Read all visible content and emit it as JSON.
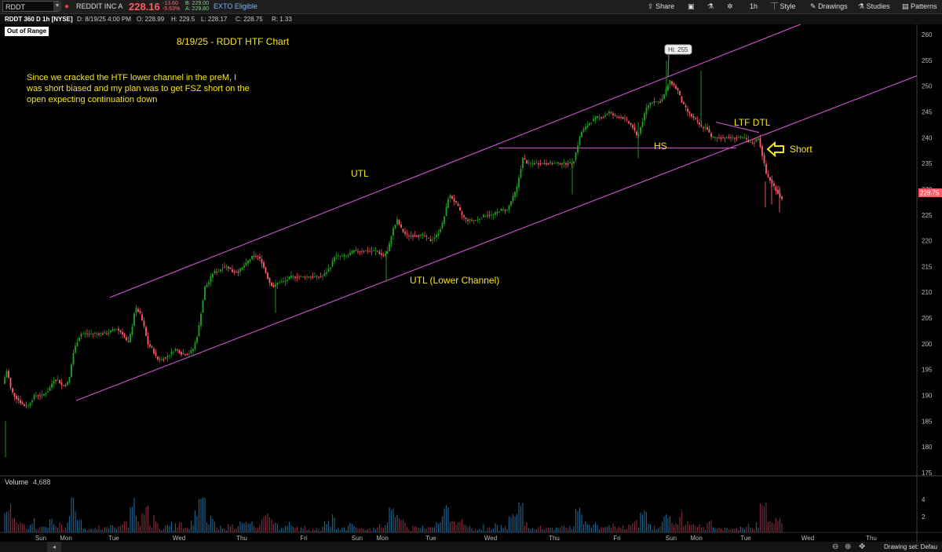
{
  "toolbar": {
    "symbol": "RDDT",
    "company": "REDDIT INC A",
    "last": "228.16",
    "change_abs": "-13.60",
    "change_pct": "-5.63%",
    "bid": "B: 229.00",
    "ask": "A: 229.80",
    "exto": "EXTO Eligible",
    "share": "Share",
    "timeframe": "1h",
    "style": "Style",
    "drawings": "Drawings",
    "studies": "Studies",
    "patterns": "Patterns"
  },
  "info": {
    "chart_desc": "RDDT 360 D 1h [NYSE]",
    "date": "D: 8/19/25 4:00 PM",
    "open": "O: 228.99",
    "high": "H: 229.5",
    "low": "L: 228.17",
    "close": "C: 228.75",
    "range": "R: 1.33"
  },
  "status": {
    "out_of_range": "Out of Range"
  },
  "annotations": {
    "title": "8/19/25 - RDDT HTF Chart",
    "note_line1": "Since we cracked the HTF lower channel in the preM, I",
    "note_line2": "was short biased and my plan was to get FSZ short on the",
    "note_line3": "open expecting continuation down",
    "utl": "UTL",
    "utl_lower": "UTL (Lower Channel)",
    "hs": "HS",
    "ltf_dtl": "LTF DTL",
    "short": "Short",
    "hi_bubble": "Hi: 255"
  },
  "volume": {
    "label": "Volume",
    "value": "4,688"
  },
  "footer": {
    "drawing_set": "Drawing set: Defau"
  },
  "colors": {
    "up": "#1fa31f",
    "down": "#ff5c6c",
    "trend": "#c050c0",
    "annotation": "#f5e61a",
    "axis": "#bbbbbb"
  },
  "chart_data": {
    "type": "candlestick",
    "price_axis_ticks": [
      175,
      180,
      185,
      190,
      195,
      200,
      205,
      210,
      215,
      220,
      225,
      230,
      235,
      240,
      245,
      250,
      255,
      260
    ],
    "volume_axis_ticks": [
      2,
      4
    ],
    "last_price_label": "228.75",
    "x_labels": [
      "Sun",
      "Mon",
      "Tue",
      "Wed",
      "Thu",
      "Fri",
      "Sun",
      "Mon",
      "Tue",
      "Wed",
      "Thu",
      "Fri",
      "Sun",
      "Mon",
      "Tue",
      "Wed",
      "Thu"
    ],
    "ylim": [
      173,
      262
    ],
    "price_path": [
      [
        0,
        183
      ],
      [
        3,
        192
      ],
      [
        9,
        195
      ],
      [
        14,
        191
      ],
      [
        18,
        190
      ],
      [
        24,
        189
      ],
      [
        30,
        188
      ],
      [
        36,
        188
      ],
      [
        44,
        190
      ],
      [
        54,
        190
      ],
      [
        62,
        191
      ],
      [
        68,
        193
      ],
      [
        74,
        193
      ],
      [
        78,
        192
      ],
      [
        84,
        192
      ],
      [
        88,
        193
      ],
      [
        93,
        198
      ],
      [
        97,
        200
      ],
      [
        103,
        202
      ],
      [
        112,
        202
      ],
      [
        124,
        202
      ],
      [
        136,
        202
      ],
      [
        148,
        203
      ],
      [
        156,
        202
      ],
      [
        163,
        200
      ],
      [
        168,
        203
      ],
      [
        172,
        207
      ],
      [
        178,
        206
      ],
      [
        184,
        203
      ],
      [
        188,
        200
      ],
      [
        194,
        199
      ],
      [
        200,
        197
      ],
      [
        208,
        197
      ],
      [
        216,
        198
      ],
      [
        224,
        199
      ],
      [
        232,
        198
      ],
      [
        240,
        198
      ],
      [
        246,
        199
      ],
      [
        252,
        202
      ],
      [
        257,
        207
      ],
      [
        261,
        211
      ],
      [
        266,
        212
      ],
      [
        272,
        214
      ],
      [
        278,
        214
      ],
      [
        284,
        215
      ],
      [
        290,
        215
      ],
      [
        296,
        214
      ],
      [
        304,
        214
      ],
      [
        310,
        215
      ],
      [
        316,
        216
      ],
      [
        322,
        217
      ],
      [
        328,
        217
      ],
      [
        333,
        216
      ],
      [
        338,
        214
      ],
      [
        343,
        212
      ],
      [
        348,
        211
      ],
      [
        355,
        212
      ],
      [
        362,
        212
      ],
      [
        370,
        213
      ],
      [
        380,
        213
      ],
      [
        390,
        213
      ],
      [
        400,
        213
      ],
      [
        410,
        213
      ],
      [
        416,
        214
      ],
      [
        421,
        215
      ],
      [
        426,
        217
      ],
      [
        434,
        217
      ],
      [
        442,
        217
      ],
      [
        450,
        218
      ],
      [
        460,
        218
      ],
      [
        470,
        218
      ],
      [
        480,
        218
      ],
      [
        488,
        217
      ],
      [
        494,
        218
      ],
      [
        500,
        222
      ],
      [
        506,
        224
      ],
      [
        512,
        222
      ],
      [
        518,
        221
      ],
      [
        525,
        221
      ],
      [
        532,
        221
      ],
      [
        540,
        221
      ],
      [
        548,
        220
      ],
      [
        556,
        221
      ],
      [
        563,
        223
      ],
      [
        568,
        226
      ],
      [
        572,
        229
      ],
      [
        577,
        228
      ],
      [
        582,
        227
      ],
      [
        588,
        225
      ],
      [
        594,
        224
      ],
      [
        600,
        224
      ],
      [
        608,
        224
      ],
      [
        618,
        225
      ],
      [
        628,
        225
      ],
      [
        638,
        226
      ],
      [
        646,
        226
      ],
      [
        652,
        228
      ],
      [
        658,
        230
      ],
      [
        662,
        233
      ],
      [
        666,
        236
      ],
      [
        672,
        235
      ],
      [
        680,
        235
      ],
      [
        690,
        235
      ],
      [
        700,
        235
      ],
      [
        712,
        235
      ],
      [
        722,
        235
      ],
      [
        730,
        235
      ],
      [
        735,
        238
      ],
      [
        740,
        241
      ],
      [
        746,
        242
      ],
      [
        752,
        243
      ],
      [
        760,
        244
      ],
      [
        768,
        244
      ],
      [
        776,
        245
      ],
      [
        784,
        244
      ],
      [
        792,
        244
      ],
      [
        800,
        243
      ],
      [
        806,
        242
      ],
      [
        812,
        240
      ],
      [
        818,
        243
      ],
      [
        824,
        246
      ],
      [
        830,
        247
      ],
      [
        836,
        247
      ],
      [
        842,
        247
      ],
      [
        848,
        249
      ],
      [
        853,
        251
      ],
      [
        859,
        250
      ],
      [
        864,
        249
      ],
      [
        868,
        247
      ],
      [
        872,
        246
      ],
      [
        876,
        245
      ],
      [
        882,
        244
      ],
      [
        888,
        243
      ],
      [
        894,
        242
      ],
      [
        900,
        242
      ],
      [
        906,
        240
      ],
      [
        912,
        240
      ],
      [
        918,
        240
      ],
      [
        926,
        240
      ],
      [
        934,
        240
      ],
      [
        942,
        240
      ],
      [
        948,
        240
      ],
      [
        954,
        239
      ],
      [
        960,
        239
      ],
      [
        966,
        240
      ],
      [
        972,
        236
      ],
      [
        976,
        233
      ],
      [
        980,
        232
      ],
      [
        984,
        231
      ],
      [
        988,
        230
      ],
      [
        992,
        229
      ],
      [
        996,
        228
      ]
    ],
    "hi_point": [
      850,
      255
    ],
    "short_marker": [
      985,
      238
    ],
    "trendlines": [
      {
        "name": "upper-channel",
        "from": [
          140,
          209
        ],
        "to": [
          1020,
          262
        ]
      },
      {
        "name": "lower-channel",
        "from": [
          97,
          189
        ],
        "to": [
          1168,
          252
        ]
      },
      {
        "name": "hs-neckline",
        "from": [
          635,
          238
        ],
        "to": [
          938,
          238
        ]
      },
      {
        "name": "ltf-dtl",
        "from": [
          912,
          243
        ],
        "to": [
          967,
          241
        ]
      }
    ]
  }
}
